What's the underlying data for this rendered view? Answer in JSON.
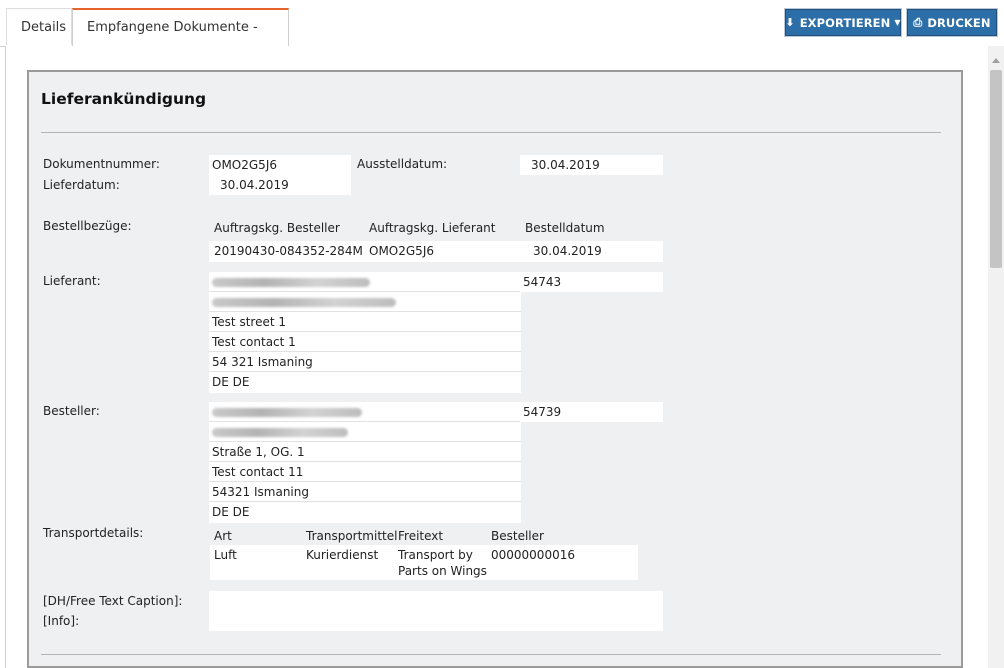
{
  "tabs": [
    {
      "label": "Details"
    },
    {
      "label": "Empfangene Dokumente - Details"
    }
  ],
  "toolbar": {
    "export_label": "EXPORTIEREN",
    "print_label": "DRUCKEN"
  },
  "document": {
    "title": "Lieferankündigung",
    "dokumentnummer_label": "Dokumentnummer:",
    "dokumentnummer": "OMO2G5J6",
    "ausstelldatum_label": "Ausstelldatum:",
    "ausstelldatum": "30.04.2019",
    "lieferdatum_label": "Lieferdatum:",
    "lieferdatum": "30.04.2019",
    "bestellbezuege": {
      "label": "Bestellbezüge:",
      "headers": [
        "Auftragskg. Besteller",
        "Auftragskg. Lieferant",
        "Bestelldatum"
      ],
      "row": [
        "20190430-084352-284M",
        "OMO2G5J6",
        "30.04.2019"
      ]
    },
    "lieferant": {
      "label": "Lieferant:",
      "id": "54743",
      "lines": [
        "Test street 1",
        "Test contact 1",
        "54 321  Ismaning",
        "DE DE"
      ]
    },
    "besteller": {
      "label": "Besteller:",
      "id": "54739",
      "lines": [
        "Straße 1, OG. 1",
        "Test contact 11",
        "54321  Ismaning",
        "DE DE"
      ]
    },
    "transport": {
      "label": "Transportdetails:",
      "headers": [
        "Art",
        "Transportmittel",
        "Freitext",
        "Besteller"
      ],
      "row": {
        "art": "Luft",
        "mittel": "Kurierdienst",
        "freitext_line1": "Transport by",
        "freitext_line2": "Parts on Wings",
        "besteller": "00000000016"
      }
    },
    "free_text_label": "[DH/Free Text Caption]:",
    "free_text_value": "",
    "info_label": "[Info]:",
    "info_value": ""
  }
}
